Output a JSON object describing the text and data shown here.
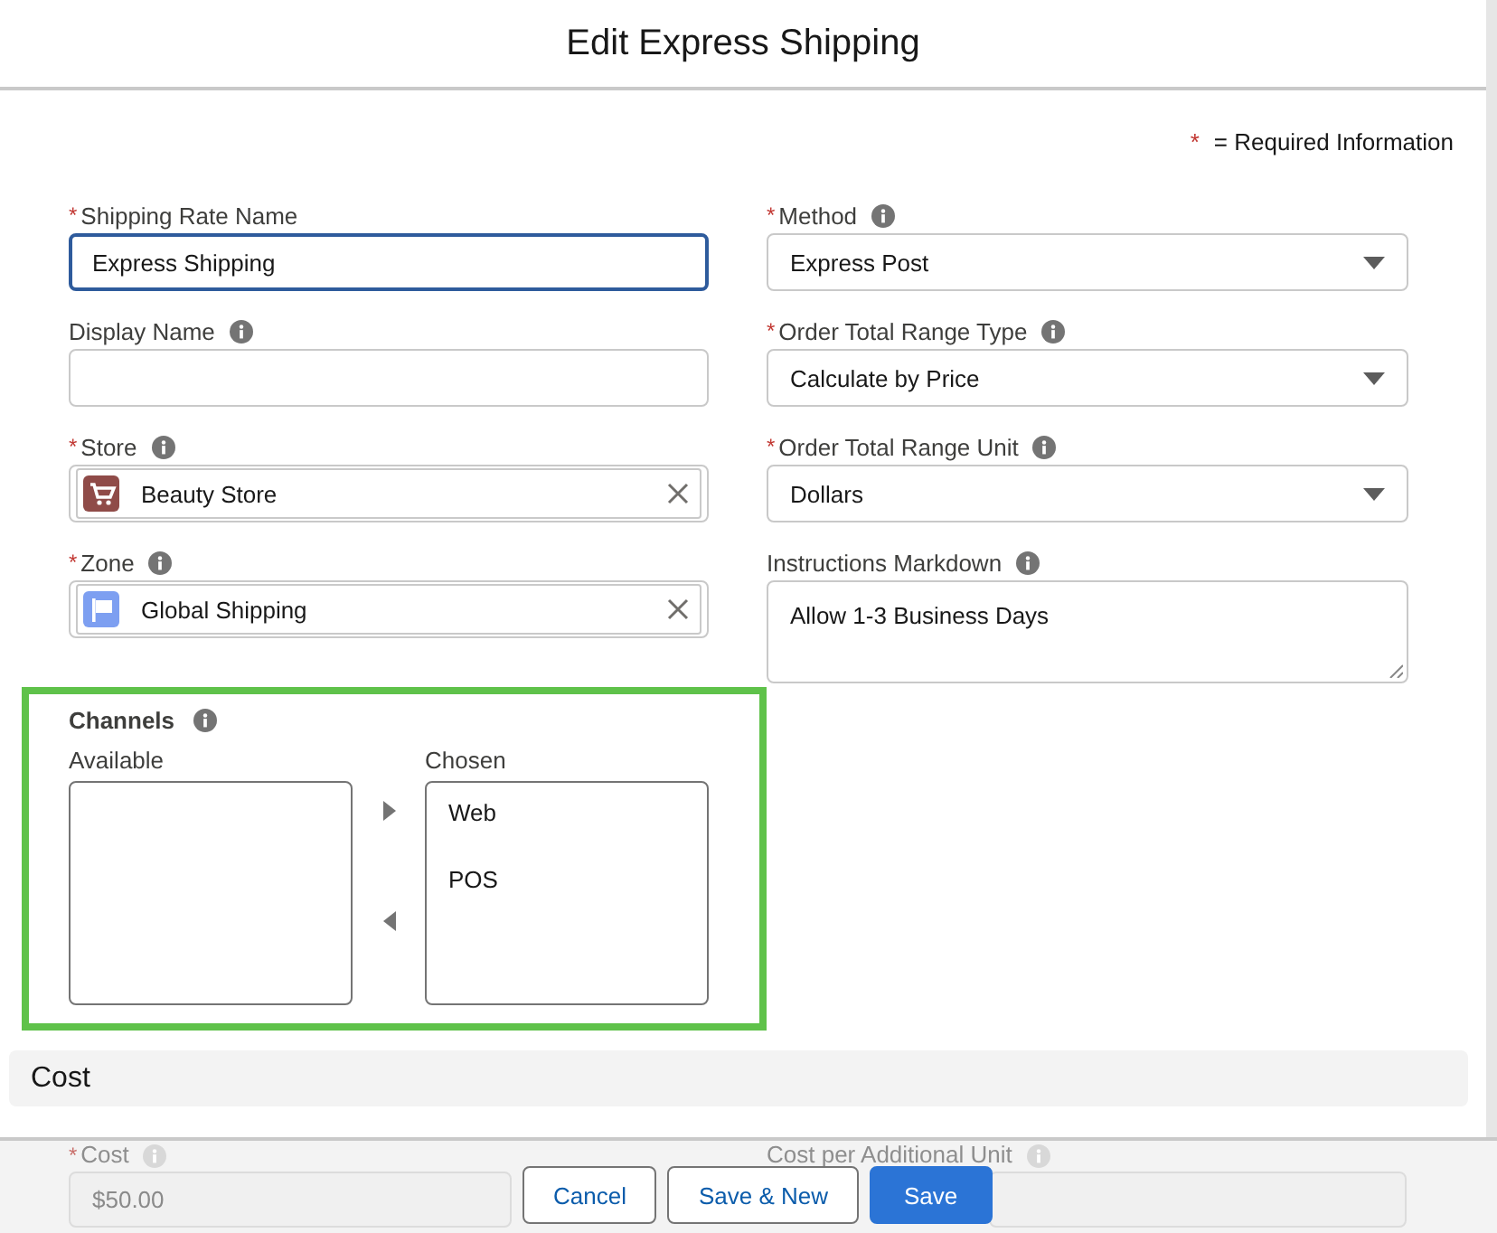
{
  "window": {
    "title": "Edit Express Shipping"
  },
  "required_legend": {
    "mark": "*",
    "text": "= Required Information"
  },
  "left_fields": [
    {
      "kind": "text",
      "label": "Shipping Rate Name",
      "required": true,
      "info": false,
      "focused": true,
      "value": "Express Shipping"
    },
    {
      "kind": "text",
      "label": "Display Name",
      "required": false,
      "info": true,
      "focused": false
    },
    {
      "kind": "lookup",
      "label": "Store",
      "required": true,
      "info": true,
      "focused": false,
      "value": "Beauty Store",
      "color": "#8f4b48"
    },
    {
      "kind": "lookup",
      "label": "Zone",
      "required": true,
      "info": true,
      "focused": false,
      "value": "Global Shipping",
      "color": "#7d9ff1"
    }
  ],
  "right_fields": [
    {
      "kind": "select",
      "label": "Method",
      "required": true,
      "info": true,
      "focused": false,
      "value": "Express Post"
    },
    {
      "kind": "select",
      "label": "Order Total Range Type",
      "required": true,
      "info": true,
      "focused": false,
      "value": "Calculate by Price"
    },
    {
      "kind": "select",
      "label": "Order Total Range Unit",
      "required": true,
      "info": true,
      "focused": false,
      "value": "Dollars"
    },
    {
      "kind": "textarea",
      "label": "Instructions Markdown",
      "required": false,
      "info": true,
      "focused": false,
      "value": "Allow 1-3 Business Days"
    }
  ],
  "channels": {
    "label": "Channels",
    "info": true,
    "available_label": "Available",
    "chosen_label": "Chosen",
    "chosen": [
      "Web",
      "POS"
    ]
  },
  "section": {
    "title": "Cost"
  },
  "hidden_fields": [
    {
      "label": "Cost",
      "required": true,
      "info": true,
      "value": "$50.00"
    },
    {
      "label": "Cost per Additional Unit",
      "required": false,
      "info": true
    }
  ],
  "buttons": [
    {
      "label": "Cancel",
      "kind": "neutral"
    },
    {
      "label": "Save & New",
      "kind": "neutral"
    },
    {
      "label": "Save",
      "kind": "brand"
    }
  ]
}
